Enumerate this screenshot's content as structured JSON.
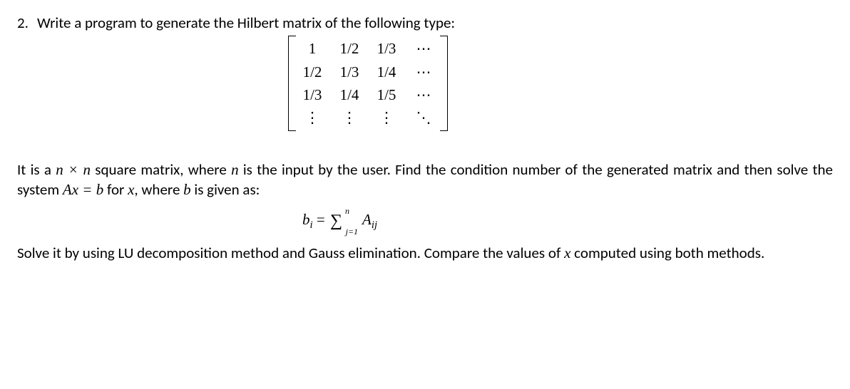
{
  "question": {
    "number": "2.",
    "prompt": "Write a program to generate the Hilbert matrix of the following type:"
  },
  "matrix": {
    "rows": [
      [
        "1",
        "1/2",
        "1/3",
        "⋯"
      ],
      [
        "1/2",
        "1/3",
        "1/4",
        "⋯"
      ],
      [
        "1/3",
        "1/4",
        "1/5",
        "⋯"
      ],
      [
        "⋮",
        "⋮",
        "⋮",
        "⋱"
      ]
    ]
  },
  "para1_parts": {
    "p1": "It is a ",
    "nxn": "n × n",
    "p2": " square matrix, where ",
    "n": "n",
    "p3": " is the input by the user. Find the condition number of the generated matrix and then solve the system ",
    "axb": "Ax = b",
    "p4": " for ",
    "x": "x",
    "p5": ", where ",
    "b": "b",
    "p6": " is given as:"
  },
  "formula": {
    "lhs_b": "b",
    "lhs_i": "i",
    "eq": " =  ",
    "sumSymbol": "∑",
    "upper": "n",
    "lower": "j=1",
    "rhs_A": "A",
    "rhs_ij": "ij"
  },
  "para2_parts": {
    "p1": "Solve it by using LU decomposition method and Gauss elimination. Compare the values of ",
    "x": "x",
    "p2": " computed using both methods."
  }
}
